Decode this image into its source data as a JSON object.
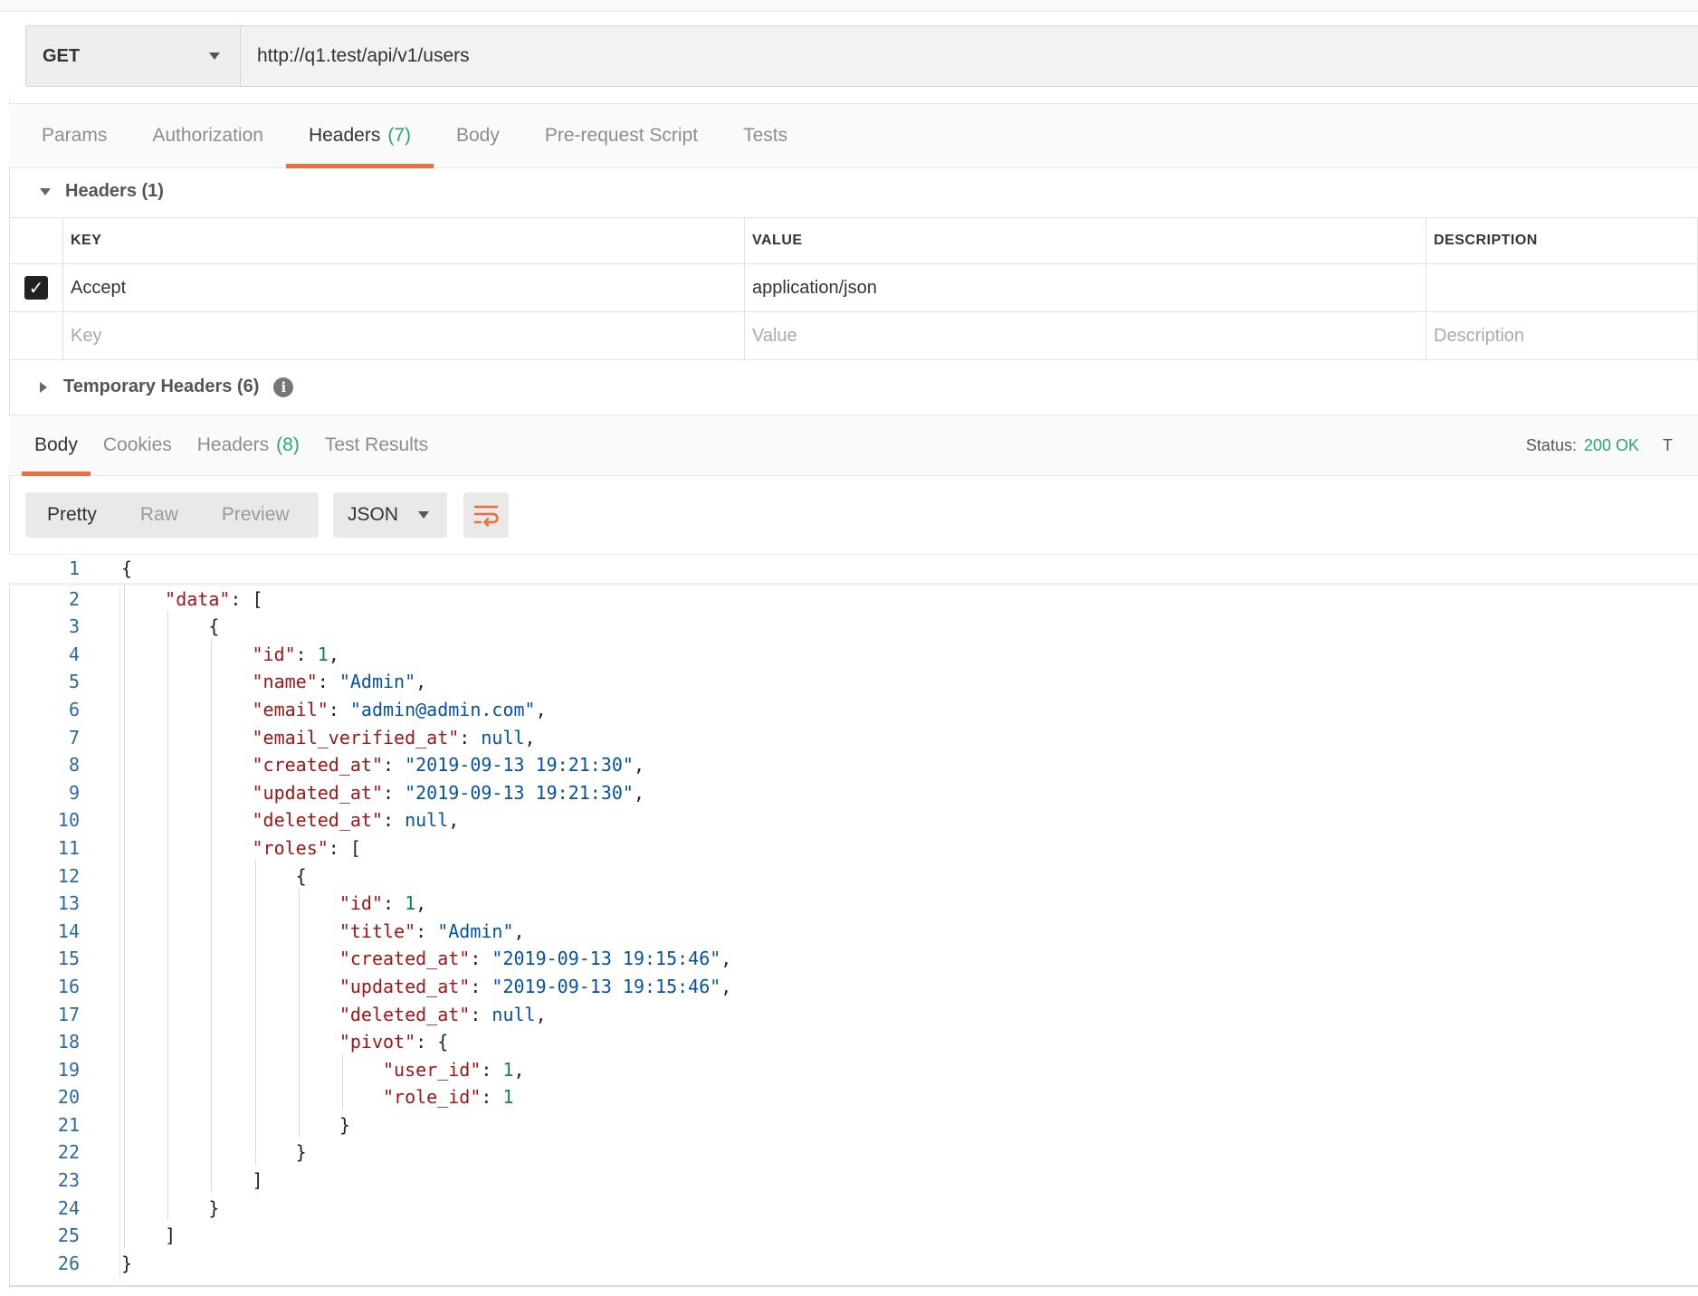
{
  "request": {
    "method": "GET",
    "url": "http://q1.test/api/v1/users"
  },
  "request_tabs": [
    {
      "label": "Params"
    },
    {
      "label": "Authorization"
    },
    {
      "label": "Headers",
      "count": "(7)"
    },
    {
      "label": "Body"
    },
    {
      "label": "Pre-request Script"
    },
    {
      "label": "Tests"
    }
  ],
  "headers_section": {
    "title": "Headers (1)",
    "columns": {
      "key": "KEY",
      "value": "VALUE",
      "description": "DESCRIPTION"
    },
    "rows": [
      {
        "checked": true,
        "key": "Accept",
        "value": "application/json",
        "description": ""
      }
    ],
    "placeholders": {
      "key": "Key",
      "value": "Value",
      "description": "Description"
    },
    "temporary_title": "Temporary Headers (6)",
    "info_glyph": "i"
  },
  "response_tabs": [
    {
      "label": "Body"
    },
    {
      "label": "Cookies"
    },
    {
      "label": "Headers",
      "count": "(8)"
    },
    {
      "label": "Test Results"
    }
  ],
  "status": {
    "label": "Status:",
    "value": "200 OK",
    "cut_text": "T"
  },
  "view_options": [
    "Pretty",
    "Raw",
    "Preview"
  ],
  "format": "JSON",
  "code_lines": [
    "{",
    "    \"data\": [",
    "        {",
    "            \"id\": 1,",
    "            \"name\": \"Admin\",",
    "            \"email\": \"admin@admin.com\",",
    "            \"email_verified_at\": null,",
    "            \"created_at\": \"2019-09-13 19:21:30\",",
    "            \"updated_at\": \"2019-09-13 19:21:30\",",
    "            \"deleted_at\": null,",
    "            \"roles\": [",
    "                {",
    "                    \"id\": 1,",
    "                    \"title\": \"Admin\",",
    "                    \"created_at\": \"2019-09-13 19:15:46\",",
    "                    \"updated_at\": \"2019-09-13 19:15:46\",",
    "                    \"deleted_at\": null,",
    "                    \"pivot\": {",
    "                        \"user_id\": 1,",
    "                        \"role_id\": 1",
    "                    }",
    "                }",
    "            ]",
    "        }",
    "    ]",
    "}"
  ],
  "icons": {
    "method_dropdown": "chevron-down-icon",
    "checkbox": "checkbox-checked-icon",
    "info": "info-icon",
    "wrap": "wrap-lines-icon"
  },
  "colors": {
    "accent": "#f26b3a",
    "status_ok": "#28a770",
    "json_key": "#a31515",
    "json_string": "#0451a5",
    "json_number": "#098658"
  }
}
